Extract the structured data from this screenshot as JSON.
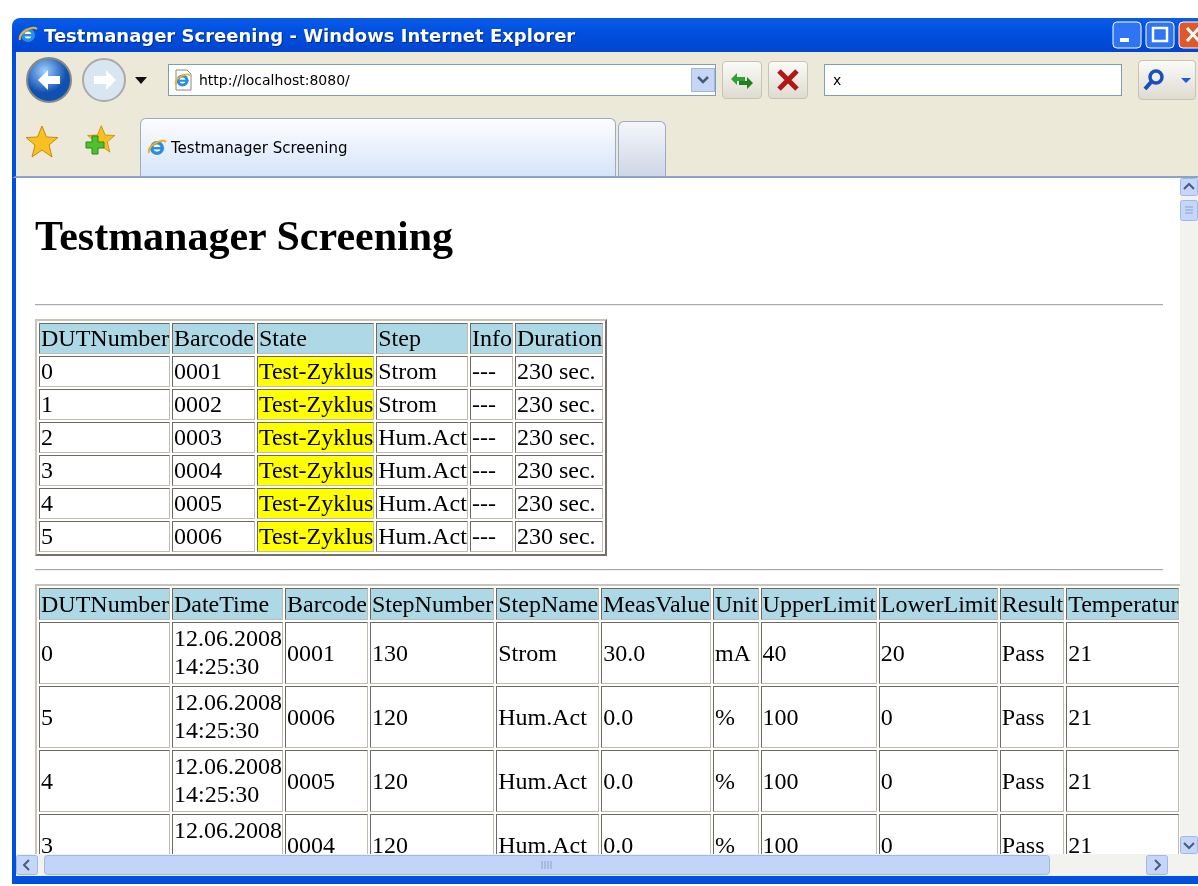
{
  "window": {
    "title": "Testmanager Screening - Windows Internet Explorer"
  },
  "address_bar": {
    "value": "http://localhost:8080/"
  },
  "search": {
    "value": "x"
  },
  "tabs": [
    {
      "label": "Testmanager Screening",
      "selected": true
    }
  ],
  "page": {
    "heading": "Testmanager Screening",
    "status_table": {
      "columns": [
        "DUTNumber",
        "Barcode",
        "State",
        "Step",
        "Info",
        "Duration"
      ],
      "rows": [
        {
          "cells": [
            "0",
            "0001",
            "Test-Zyklus",
            "Strom",
            "---",
            "230 sec."
          ],
          "color": "#ffff00"
        },
        {
          "cells": [
            "1",
            "0002",
            "Test-Zyklus",
            "Strom",
            "---",
            "230 sec."
          ],
          "color": "#ffff00"
        },
        {
          "cells": [
            "2",
            "0003",
            "Test-Zyklus",
            "Hum.Act",
            "---",
            "230 sec."
          ],
          "color": "#ffff00"
        },
        {
          "cells": [
            "3",
            "0004",
            "Test-Zyklus",
            "Hum.Act",
            "---",
            "230 sec."
          ],
          "color": "#ffff00"
        },
        {
          "cells": [
            "4",
            "0005",
            "Test-Zyklus",
            "Hum.Act",
            "---",
            "230 sec."
          ],
          "color": "#ffff00"
        },
        {
          "cells": [
            "5",
            "0006",
            "Test-Zyklus",
            "Hum.Act",
            "---",
            "230 sec."
          ],
          "color": "#ffff00"
        }
      ]
    },
    "results_table": {
      "columns": [
        "DUTNumber",
        "DateTime",
        "Barcode",
        "StepNumber",
        "StepName",
        "MeasValue",
        "Unit",
        "UpperLimit",
        "LowerLimit",
        "Result",
        "Temperatur"
      ],
      "rows": [
        {
          "cells": [
            "0",
            "12.06.2008 14:25:30",
            "0001",
            "130",
            "Strom",
            "30.0",
            "mA",
            "40",
            "20",
            "Pass",
            "21"
          ]
        },
        {
          "cells": [
            "5",
            "12.06.2008 14:25:30",
            "0006",
            "120",
            "Hum.Act",
            "0.0",
            "%",
            "100",
            "0",
            "Pass",
            "21"
          ]
        },
        {
          "cells": [
            "4",
            "12.06.2008 14:25:30",
            "0005",
            "120",
            "Hum.Act",
            "0.0",
            "%",
            "100",
            "0",
            "Pass",
            "21"
          ]
        },
        {
          "cells": [
            "3",
            "12.06.2008",
            "0004",
            "120",
            "Hum.Act",
            "0.0",
            "%",
            "100",
            "0",
            "Pass",
            "21"
          ]
        }
      ]
    }
  }
}
